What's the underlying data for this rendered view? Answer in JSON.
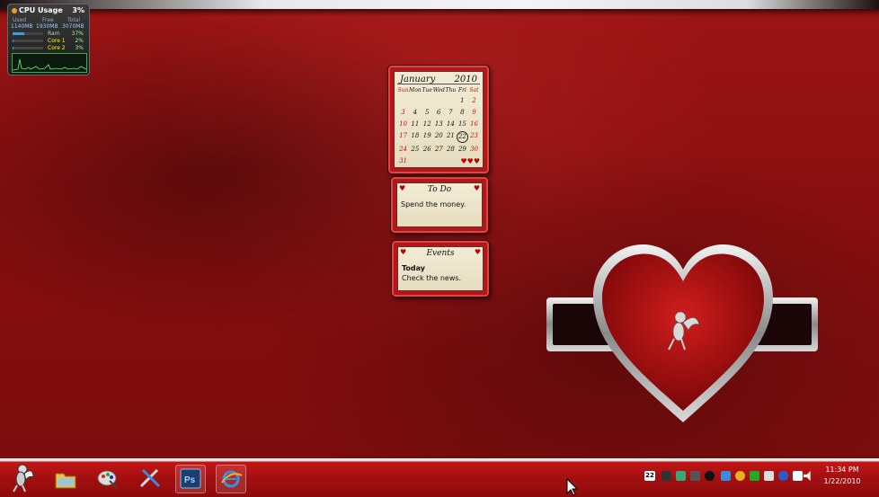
{
  "cpu_gadget": {
    "title": "CPU Usage",
    "percent": "3%",
    "used_label": "Used",
    "free_label": "Free",
    "total_label": "Total",
    "used_value": "1140MB",
    "free_value": "1930MB",
    "total_value": "3070MB",
    "ram_label": "Ram",
    "ram_value": "37%",
    "core1_label": "Core 1",
    "core1_value": "2%",
    "core2_label": "Core 2",
    "core2_value": "3%",
    "ram_fraction": 0.37,
    "core1_fraction": 0.02,
    "core2_fraction": 0.03
  },
  "calendar": {
    "month": "January",
    "year": "2010",
    "weekdays": [
      "Sun",
      "Mon",
      "Tue",
      "Wed",
      "Thu",
      "Fri",
      "Sat"
    ],
    "days": [
      "",
      "",
      "",
      "",
      "",
      "1",
      "2",
      "3",
      "4",
      "5",
      "6",
      "7",
      "8",
      "9",
      "10",
      "11",
      "12",
      "13",
      "14",
      "15",
      "16",
      "17",
      "18",
      "19",
      "20",
      "21",
      "22",
      "23",
      "24",
      "25",
      "26",
      "27",
      "28",
      "29",
      "30",
      "31",
      "",
      "",
      "",
      "",
      "",
      ""
    ],
    "today": "22"
  },
  "todo": {
    "title": "To Do",
    "text": "Spend the money."
  },
  "events": {
    "title": "Events",
    "heading": "Today",
    "text": "Check the news."
  },
  "clock": {
    "time": "11:34 PM",
    "date": "1/22/2010"
  },
  "tray": {
    "date_badge": "22"
  },
  "colors": {
    "wallpaper": "#8a0f10",
    "accent": "#c41616",
    "paper": "#f3ecd5"
  }
}
